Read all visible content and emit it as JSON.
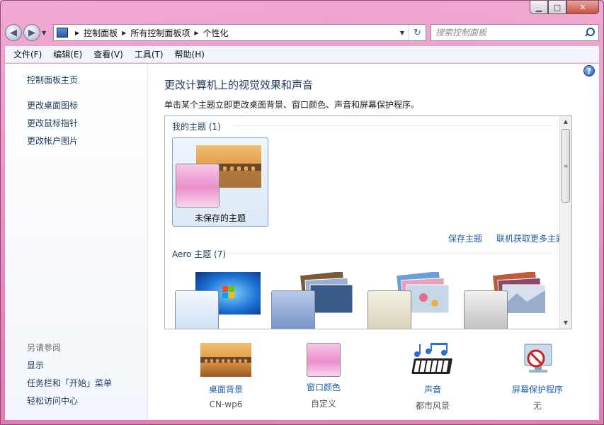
{
  "window": {
    "caption_buttons": {
      "minimize": "▁",
      "maximize": "□",
      "close": "✕"
    }
  },
  "navigation": {
    "back_icon": "◀",
    "forward_icon": "▶",
    "breadcrumb": [
      "控制面板",
      "所有控制面板项",
      "个性化"
    ],
    "refresh_icon": "↻",
    "search_placeholder": "搜索控制面板"
  },
  "menubar": [
    "文件(F)",
    "编辑(E)",
    "查看(V)",
    "工具(T)",
    "帮助(H)"
  ],
  "sidebar": {
    "home_link": "控制面板主页",
    "links": [
      "更改桌面图标",
      "更改鼠标指针",
      "更改帐户图片"
    ],
    "see_also_label": "另请参阅",
    "see_also_links": [
      "显示",
      "任务栏和「开始」菜单",
      "轻松访问中心"
    ]
  },
  "main": {
    "help_icon": "?",
    "title": "更改计算机上的视觉效果和声音",
    "description": "单击某个主题立即更改桌面背景、窗口颜色、声音和屏幕保护程序。",
    "my_themes_header": "我的主题 (1)",
    "unsaved_theme_label": "未保存的主题",
    "save_theme_link": "保存主题",
    "get_more_themes_link": "联机获取更多主题",
    "aero_themes_header": "Aero 主题 (7)"
  },
  "settings": [
    {
      "label": "桌面背景",
      "value": "CN-wp6"
    },
    {
      "label": "窗口颜色",
      "value": "自定义"
    },
    {
      "label": "声音",
      "value": "都市风景"
    },
    {
      "label": "屏幕保护程序",
      "value": "无"
    }
  ],
  "colors": {
    "window_accent": "#e27ab8",
    "link_blue": "#1e5fa8",
    "title_blue": "#1e395b",
    "custom_color_pink": "#f3a6d6"
  }
}
